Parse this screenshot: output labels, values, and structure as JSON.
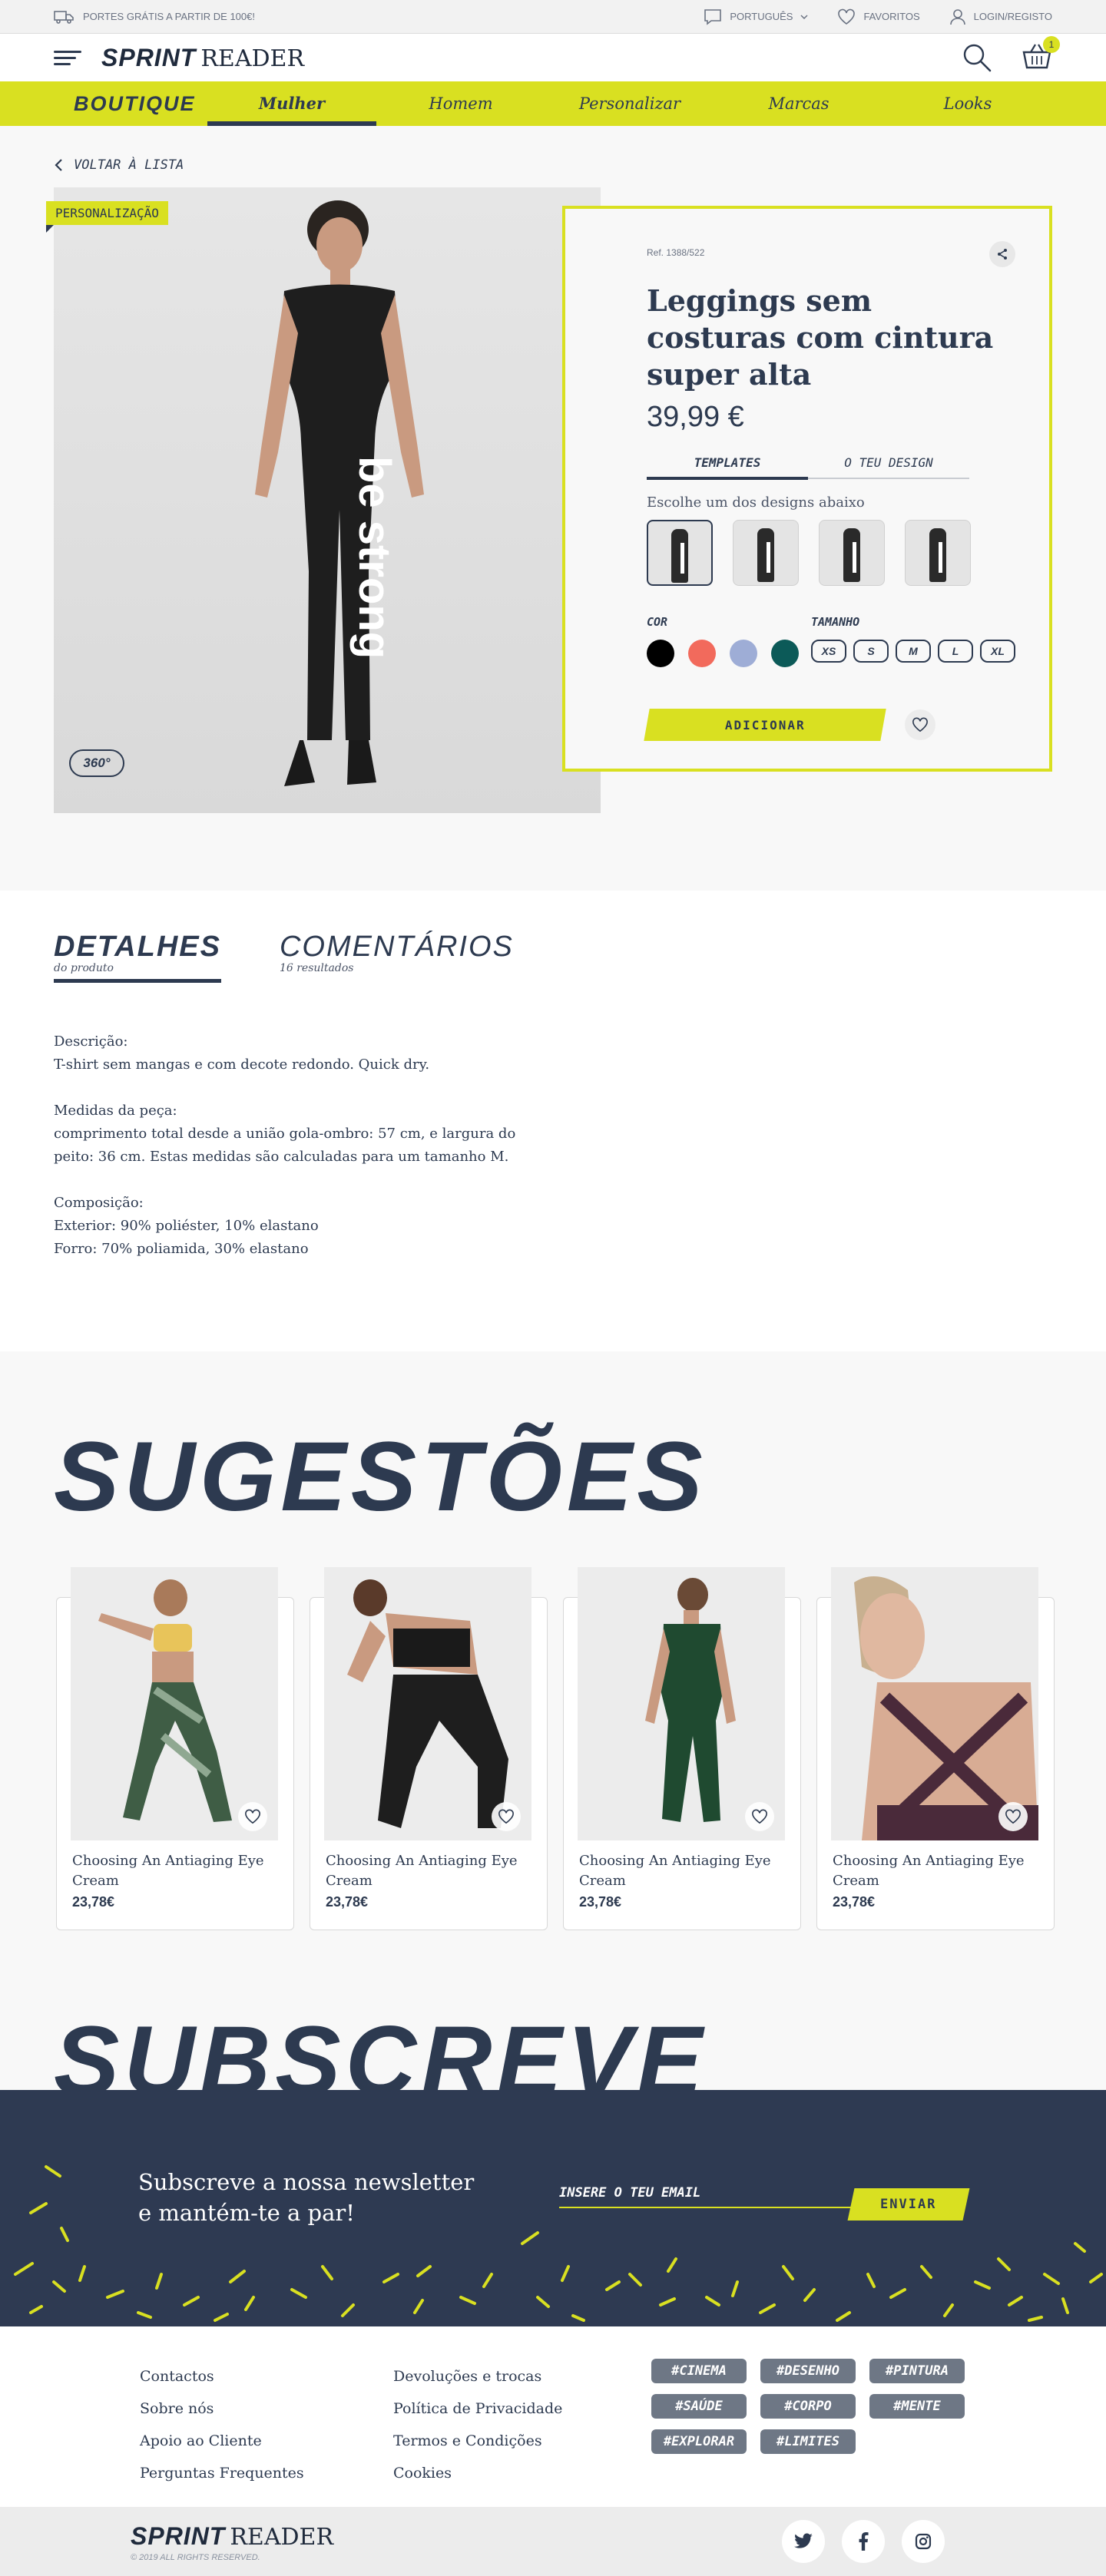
{
  "topbar": {
    "shipping": "PORTES GRÁTIS A PARTIR DE 100€!",
    "language": "PORTUGUÊS",
    "favorites": "FAVORITOS",
    "login": "LOGIN/REGISTO"
  },
  "header": {
    "logo_bold": "SPRINT",
    "logo_regular": "READER",
    "cart_count": "1"
  },
  "nav": {
    "brand": "BOUTIQUE",
    "items": [
      "Mulher",
      "Homem",
      "Personalizar",
      "Marcas",
      "Looks"
    ],
    "active_index": 0
  },
  "product": {
    "back_label": "VOLTAR À LISTA",
    "personalization_tag": "PERSONALIZAÇÃO",
    "print_text": "be strong",
    "badge_360": "360°",
    "ref": "Ref. 1388/522",
    "title": "Leggings sem costuras com cintura super alta",
    "price": "39,99 €",
    "tabs": [
      "TEMPLATES",
      "O TEU DESIGN"
    ],
    "choose_label": "Escolhe um dos designs abaixo",
    "color_label": "COR",
    "size_label": "TAMANHO",
    "colors": [
      "#000000",
      "#f26a5c",
      "#9eadd6",
      "#0c5a58"
    ],
    "sizes": [
      "XS",
      "S",
      "M",
      "L",
      "XL"
    ],
    "add_button": "ADICIONAR"
  },
  "details": {
    "tabs": [
      {
        "title": "DETALHES",
        "subtitle": "do produto"
      },
      {
        "title": "COMENTÁRIOS",
        "subtitle": "16 resultados"
      }
    ],
    "desc_label": "Descrição:",
    "desc_text": "T-shirt sem mangas e com decote redondo. Quick dry.",
    "measures_label": "Medidas da peça:",
    "measures_text": "comprimento total desde a união gola-ombro: 57 cm, e largura do peito: 36 cm. Estas medidas são calculadas para um tamanho M.",
    "composition_label": "Composição:",
    "composition_1": "Exterior: 90% poliéster, 10% elastano",
    "composition_2": "Forro: 70% poliamida, 30% elastano"
  },
  "suggestions": {
    "title": "SUGESTÕES",
    "items": [
      {
        "name": "Choosing An Antiaging Eye Cream",
        "price": "23,78€"
      },
      {
        "name": "Choosing An Antiaging Eye Cream",
        "price": "23,78€"
      },
      {
        "name": "Choosing An Antiaging Eye Cream",
        "price": "23,78€"
      },
      {
        "name": "Choosing An Antiaging Eye Cream",
        "price": "23,78€"
      }
    ]
  },
  "subscribe": {
    "title": "SUBSCREVE",
    "line1": "Subscreve a nossa newsletter",
    "line2": "e mantém-te a par!",
    "placeholder": "INSERE O TEU EMAIL",
    "button": "ENVIAR"
  },
  "footer": {
    "col1": [
      "Contactos",
      "Sobre nós",
      "Apoio ao Cliente",
      "Perguntas Frequentes"
    ],
    "col2": [
      "Devoluções e trocas",
      "Política de Privacidade",
      "Termos e Condições",
      "Cookies"
    ],
    "tags": [
      "#CINEMA",
      "#DESENHO",
      "#PINTURA",
      "#SAÚDE",
      "#CORPO",
      "#MENTE",
      "#EXPLORAR",
      "#LIMITES"
    ],
    "copyright": "© 2019 ALL RIGHTS RESERVED."
  },
  "colors": {
    "accent": "#d9e021",
    "navy": "#2d3a50",
    "newsletter_bg": "#2e3a52"
  }
}
